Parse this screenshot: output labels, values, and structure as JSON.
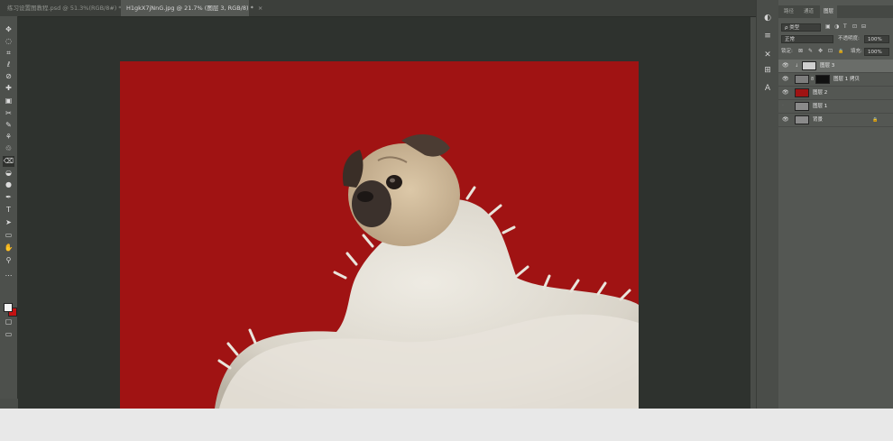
{
  "tabs": [
    {
      "label": "练习设置图教程.psd @ 51.3%(RGB/8#) *",
      "close": "×"
    },
    {
      "label": "H1gkX7jNnG.jpg @ 21.7% (图层 3, RGB/8) *",
      "close": "×"
    }
  ],
  "toolbar": {
    "tools": [
      "move-tool",
      "marquee-tool",
      "crop-tool",
      "lasso-tool",
      "eyedropper-tool",
      "spot-heal-tool",
      "gradient-tool",
      "pen-anchor-tool",
      "brush-tool",
      "clone-stamp-tool",
      "history-brush-tool",
      "eraser-tool",
      "blur-tool",
      "dodge-tool",
      "pen-tool",
      "type-tool",
      "path-select-tool",
      "rectangle-tool",
      "hand-tool",
      "zoom-tool",
      "more-tools"
    ],
    "glyphs": [
      "✥",
      "◌",
      "⌗",
      "ℓ",
      "⊘",
      "✚",
      "▣",
      "✂",
      "✎",
      "⚘",
      "♲",
      "⌫",
      "◒",
      "●",
      "✒",
      "T",
      "➤",
      "▭",
      "✋",
      "⚲",
      "⋯"
    ],
    "fg_color": "#f2f2f2",
    "bg_color": "#c31212",
    "mode_glyphs": [
      "▢",
      "▭"
    ]
  },
  "canvas": {
    "doc_color": "#a01313",
    "area_color": "#2e322e"
  },
  "right_strip": {
    "icons": [
      "◐",
      "≡",
      "✕",
      "⊞",
      "A"
    ]
  },
  "layers_panel": {
    "tabs": [
      "路径",
      "通道",
      "图层"
    ],
    "filter": {
      "kind": "ρ 类型",
      "icons": [
        "▣",
        "◑",
        "T",
        "⊡",
        "⊟"
      ]
    },
    "blend_mode": "正常",
    "opacity_label": "不透明度:",
    "opacity_value": "100%",
    "lock_label": "锁定:",
    "lock_icons": [
      "⊠",
      "✎",
      "✥",
      "⊡",
      "🔒"
    ],
    "fill_label": "填充:",
    "fill_value": "100%",
    "layers": [
      {
        "name": "图层 3",
        "visible": true,
        "selected": true,
        "thumb": "#c8c8c8"
      },
      {
        "name": "图层 1 拷贝",
        "visible": true,
        "selected": false,
        "thumb": "#7d7d7d",
        "mask": true
      },
      {
        "name": "图层 2",
        "visible": true,
        "selected": false,
        "thumb": "#a01313"
      },
      {
        "name": "图层 1",
        "visible": false,
        "selected": false,
        "thumb": "#8a8a8a"
      },
      {
        "name": "背景",
        "visible": true,
        "selected": false,
        "thumb": "#8a8a8a",
        "locked": true
      }
    ]
  }
}
